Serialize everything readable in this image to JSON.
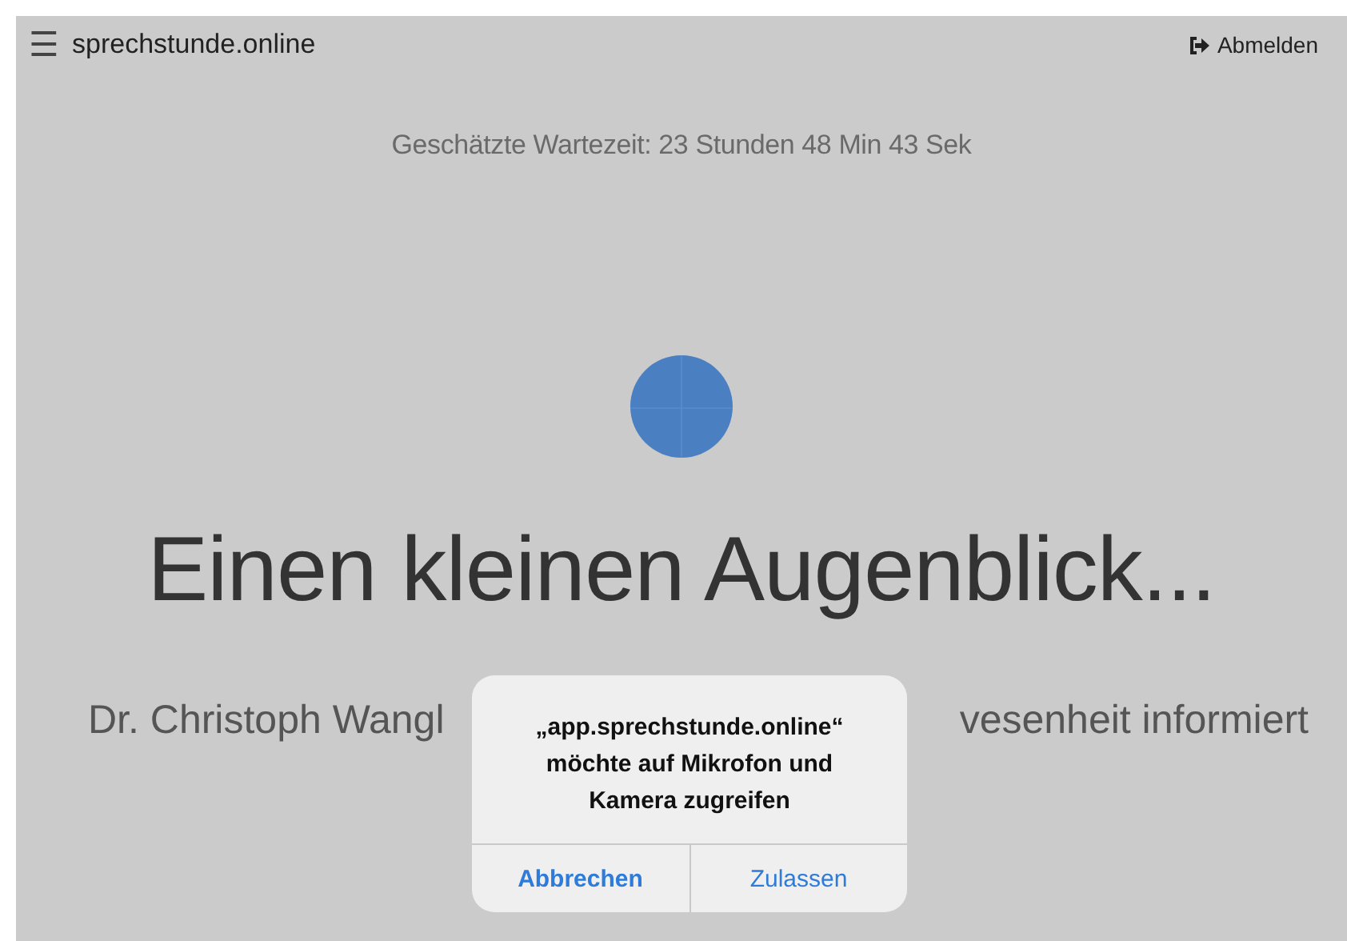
{
  "header": {
    "menu_icon": "☰",
    "title": "sprechstunde.online",
    "logout": "Abmelden"
  },
  "wait_time": "Geschätzte Wartezeit: 23 Stunden 48 Min 43 Sek",
  "heading": "Einen kleinen Augenblick...",
  "subtitle_fragments": [
    "Dr. Christoph Wangl",
    "vesenheit informiert"
  ],
  "dialog": {
    "message": "„app.sprechstunde.online“ möchte auf Mikrofon und Kamera zugreifen",
    "buttons": [
      {
        "label": "Abbrechen",
        "primary": true
      },
      {
        "label": "Zulassen",
        "primary": false
      }
    ]
  }
}
